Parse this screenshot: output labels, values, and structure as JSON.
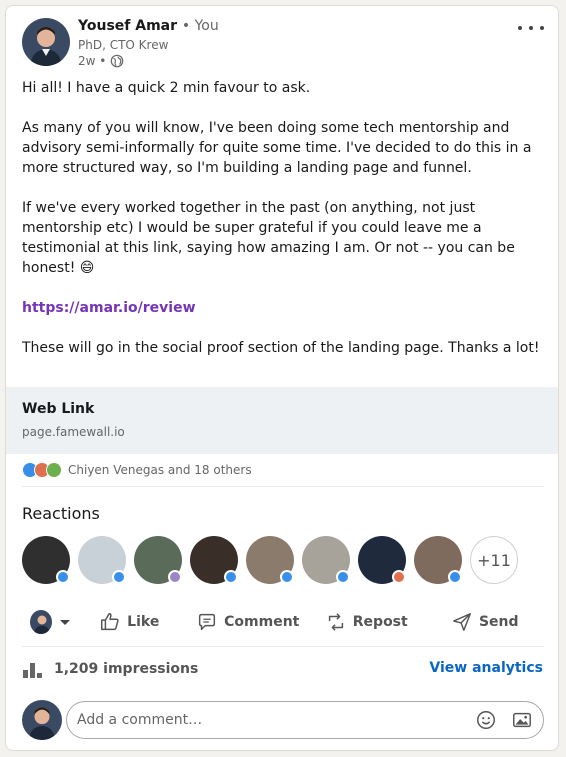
{
  "post": {
    "author_name": "Yousef Amar",
    "author_you": "• You",
    "author_headline": "PhD, CTO Krew",
    "time": "2w •",
    "paragraphs": [
      "Hi all! I have a quick 2 min favour to ask.",
      "As many of you will know, I've been doing some tech mentorship and advisory semi-informally for quite some time. I've decided to do this in a more structured way, so I'm building a landing page and funnel.",
      "If we've every worked together in the past (on anything, not just mentorship etc) I would be super grateful if you could leave me a testimonial at this link, saying how amazing I am. Or not -- you can be honest! 😄",
      "These will go in the social proof section of the landing page. Thanks a lot!"
    ],
    "link_url": "https://amar.io/review"
  },
  "link_preview": {
    "title": "Web Link",
    "domain": "page.famewall.io"
  },
  "social": {
    "summary": "Chiyen Venegas and 18 others"
  },
  "reactions": {
    "heading": "Reactions",
    "more": "+11"
  },
  "actions": {
    "like": "Like",
    "comment": "Comment",
    "repost": "Repost",
    "send": "Send"
  },
  "stats": {
    "impressions": "1,209 impressions",
    "view_analytics": "View analytics"
  },
  "comment": {
    "placeholder": "Add a comment…"
  },
  "icons": {
    "more": "more-icon",
    "globe": "globe-icon",
    "like": "thumbs-up-icon",
    "comment": "comment-icon",
    "repost": "repost-icon",
    "send": "send-icon",
    "impressions": "bar-chart-icon",
    "emoji": "emoji-icon",
    "image": "image-icon"
  },
  "colors": {
    "link": "#7535b8",
    "accent": "#0a66c2",
    "preview_bg": "#edf1f4",
    "like_blue": "#378fe9",
    "love_red": "#df704d"
  }
}
